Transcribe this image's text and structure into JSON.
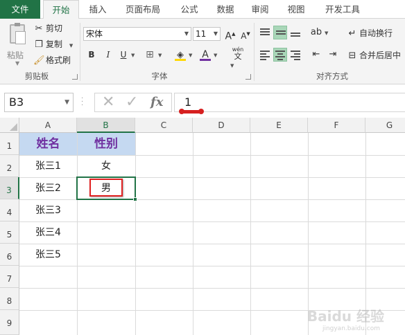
{
  "tabs": {
    "file": "文件",
    "home": "开始",
    "insert": "插入",
    "page_layout": "页面布局",
    "formulas": "公式",
    "data": "数据",
    "review": "审阅",
    "view": "视图",
    "developer": "开发工具"
  },
  "clipboard": {
    "paste": "粘贴",
    "cut": "剪切",
    "copy": "复制",
    "format_painter": "格式刷",
    "group_label": "剪贴板"
  },
  "font": {
    "name": "宋体",
    "size": "11",
    "bold": "B",
    "italic": "I",
    "underline": "U",
    "font_color_letter": "A",
    "phonetic": "wén",
    "group_label": "字体"
  },
  "alignment": {
    "wrap_text": "自动换行",
    "merge_center": "合并后居中",
    "group_label": "对齐方式"
  },
  "formula_bar": {
    "name_box": "B3",
    "fx": "fx",
    "value": "1"
  },
  "columns": [
    "A",
    "B",
    "C",
    "D",
    "E",
    "F",
    "G"
  ],
  "rows": [
    "1",
    "2",
    "3",
    "4",
    "5",
    "6",
    "7",
    "8",
    "9"
  ],
  "cells": {
    "A1": "姓名",
    "B1": "性别",
    "A2": "张三1",
    "B2": "女",
    "A3": "张三2",
    "B3": "男",
    "A4": "张三3",
    "A5": "张三4",
    "A6": "张三5"
  },
  "watermark": "Baidu 经验",
  "watermark_sub": "jingyan.baidu.com",
  "colors": {
    "accent": "#217346",
    "header_fill": "#c5d9f1",
    "header_text": "#7030a0",
    "annotation": "#e02020"
  }
}
